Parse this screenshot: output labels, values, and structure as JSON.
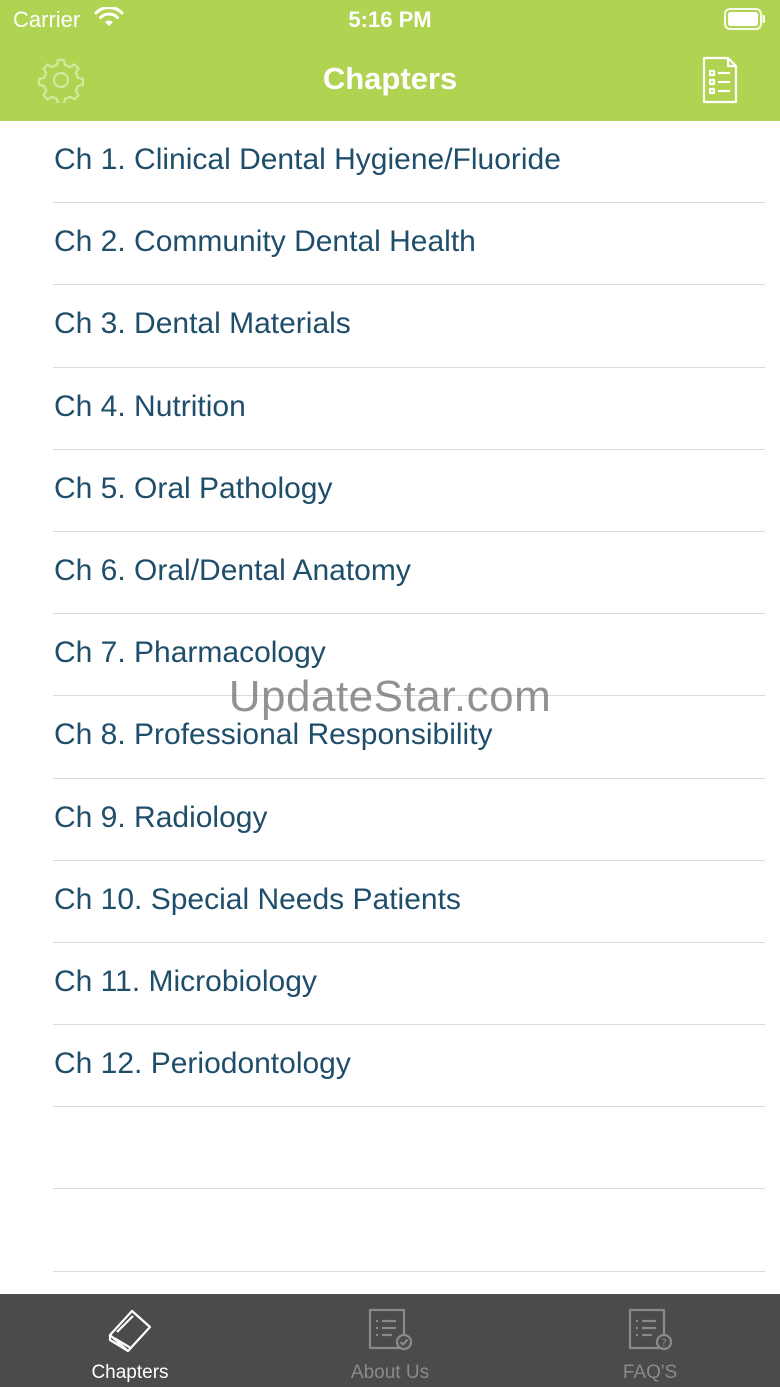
{
  "status_bar": {
    "carrier": "Carrier",
    "time": "5:16 PM"
  },
  "nav": {
    "title": "Chapters",
    "left_icon": "settings-gear-icon",
    "right_icon": "document-list-icon"
  },
  "chapters": [
    {
      "label": "Ch 1. Clinical Dental Hygiene/Fluoride"
    },
    {
      "label": "Ch 2. Community Dental Health"
    },
    {
      "label": "Ch 3. Dental Materials"
    },
    {
      "label": "Ch 4. Nutrition"
    },
    {
      "label": "Ch 5. Oral Pathology"
    },
    {
      "label": "Ch 6. Oral/Dental Anatomy"
    },
    {
      "label": "Ch 7. Pharmacology"
    },
    {
      "label": "Ch 8. Professional Responsibility"
    },
    {
      "label": "Ch 9. Radiology"
    },
    {
      "label": "Ch 10. Special Needs Patients"
    },
    {
      "label": "Ch 11. Microbiology"
    },
    {
      "label": "Ch 12. Periodontology"
    },
    {
      "label": ""
    },
    {
      "label": ""
    }
  ],
  "watermark": "UpdateStar.com",
  "tabs": [
    {
      "label": "Chapters",
      "icon": "book-icon",
      "active": true
    },
    {
      "label": "About Us",
      "icon": "document-check-icon",
      "active": false
    },
    {
      "label": "FAQ'S",
      "icon": "document-question-icon",
      "active": false
    }
  ],
  "colors": {
    "header": "#b0d352",
    "list_text": "#1f4e6b",
    "tabbar": "#4b4b4b",
    "separator": "#d9d9d9"
  }
}
